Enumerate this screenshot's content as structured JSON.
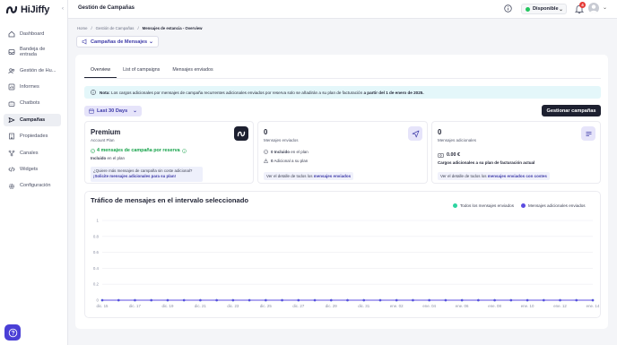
{
  "brand": {
    "name": "HiJiffy"
  },
  "sidebar": {
    "items": [
      {
        "label": "Dashboard",
        "icon": "home-icon",
        "active": false
      },
      {
        "label": "Bandeja de entrada",
        "icon": "inbox-icon",
        "active": false
      },
      {
        "label": "Gestión de Hu...",
        "icon": "users-icon",
        "active": false
      },
      {
        "label": "Informes",
        "icon": "chart-icon",
        "active": false
      },
      {
        "label": "Chatbots",
        "icon": "chatbot-icon",
        "active": false
      },
      {
        "label": "Campañas",
        "icon": "send-icon",
        "active": true
      },
      {
        "label": "Propiedades",
        "icon": "building-icon",
        "active": false
      },
      {
        "label": "Canales",
        "icon": "channels-icon",
        "active": false
      },
      {
        "label": "Widgets",
        "icon": "code-icon",
        "active": false
      },
      {
        "label": "Configuración",
        "icon": "gear-icon",
        "active": false
      }
    ]
  },
  "topbar": {
    "title": "Gestión de Campañas",
    "status": "Disponible",
    "notifications_count": "4"
  },
  "breadcrumb": [
    "Home",
    "Gestión de Campañas",
    "Mensajes de estancia - Overview"
  ],
  "campaign_selector": {
    "label": "Campañas de Mensajes"
  },
  "tabs": [
    "Overview",
    "List of campaigns",
    "Mensajes enviados"
  ],
  "note": {
    "prefix": "Nota:",
    "text": "Los cargos adicionales por mensajes de campaña recurrentes adicionales enviados por reserva solo se añadirán a su plan de facturación",
    "emphasis": "a partir del 1 de enero de 2025."
  },
  "date_range": {
    "label": "Last 30 Days"
  },
  "manage_button": {
    "label": "Gestionar campañas"
  },
  "plan_card": {
    "title": "Premium",
    "subtitle": "Account Plan",
    "highlight": "4 mensajes de campaña por reserva",
    "included": "Incluido",
    "included_suffix": " en el plan",
    "upsell_question": "¿Quiere más mensajes de campaña sin coste adicional?",
    "upsell_link": "¡Solicite mensajes adicionales para su plan!"
  },
  "sent_card": {
    "value": "0",
    "label": "Mensajes enviados",
    "included_value": "0 Incluido",
    "included_suffix": " en el plan",
    "additional_value": "0",
    "additional_suffix": " Adicional a su plan",
    "detail_prefix": "Ver el detalle de todos los ",
    "detail_link": "mensajes enviados"
  },
  "additional_card": {
    "value": "0",
    "label": "Mensajes adicionales",
    "amount": "0.00 €",
    "amount_label": "Cargos adicionales a su plan de facturación actual",
    "detail_prefix": "Ver el detalle de todos los ",
    "detail_link": "mensajes enviados con costes"
  },
  "chart_section": {
    "title": "Tráfico de mensajes en el intervalo seleccionado"
  },
  "chart_data": {
    "type": "line",
    "x": [
      "dic. 15",
      "dic. 16",
      "dic. 17",
      "dic. 18",
      "dic. 19",
      "dic. 20",
      "dic. 21",
      "dic. 22",
      "dic. 23",
      "dic. 24",
      "dic. 25",
      "dic. 26",
      "dic. 27",
      "dic. 28",
      "dic. 29",
      "dic. 30",
      "dic. 31",
      "ene. 01",
      "ene. 02",
      "ene. 03",
      "ene. 04",
      "ene. 05",
      "ene. 06",
      "ene. 07",
      "ene. 08",
      "ene. 09",
      "ene. 10",
      "ene. 11",
      "ene. 12",
      "ene. 13",
      "ene. 14"
    ],
    "x_tick_labels": [
      "dic. 15",
      "dic. 17",
      "dic. 19",
      "dic. 21",
      "dic. 23",
      "dic. 25",
      "dic. 27",
      "dic. 29",
      "dic. 31",
      "ene. 02",
      "ene. 04",
      "ene. 06",
      "ene. 08",
      "ene. 10",
      "ene. 12",
      "ene. 14"
    ],
    "y_tick_labels": [
      "0",
      "0.2",
      "0.4",
      "0.6",
      "0.8",
      "1"
    ],
    "ylim": [
      0,
      1
    ],
    "series": [
      {
        "name": "Todos los mensajes enviados",
        "color": "#2dd4a0",
        "values": [
          0,
          0,
          0,
          0,
          0,
          0,
          0,
          0,
          0,
          0,
          0,
          0,
          0,
          0,
          0,
          0,
          0,
          0,
          0,
          0,
          0,
          0,
          0,
          0,
          0,
          0,
          0,
          0,
          0,
          0,
          0
        ]
      },
      {
        "name": "Mensajes adicionales enviados",
        "color": "#5b4ce0",
        "values": [
          0,
          0,
          0,
          0,
          0,
          0,
          0,
          0,
          0,
          0,
          0,
          0,
          0,
          0,
          0,
          0,
          0,
          0,
          0,
          0,
          0,
          0,
          0,
          0,
          0,
          0,
          0,
          0,
          0,
          0,
          0
        ]
      }
    ],
    "legend": "top-right",
    "grid": true
  }
}
